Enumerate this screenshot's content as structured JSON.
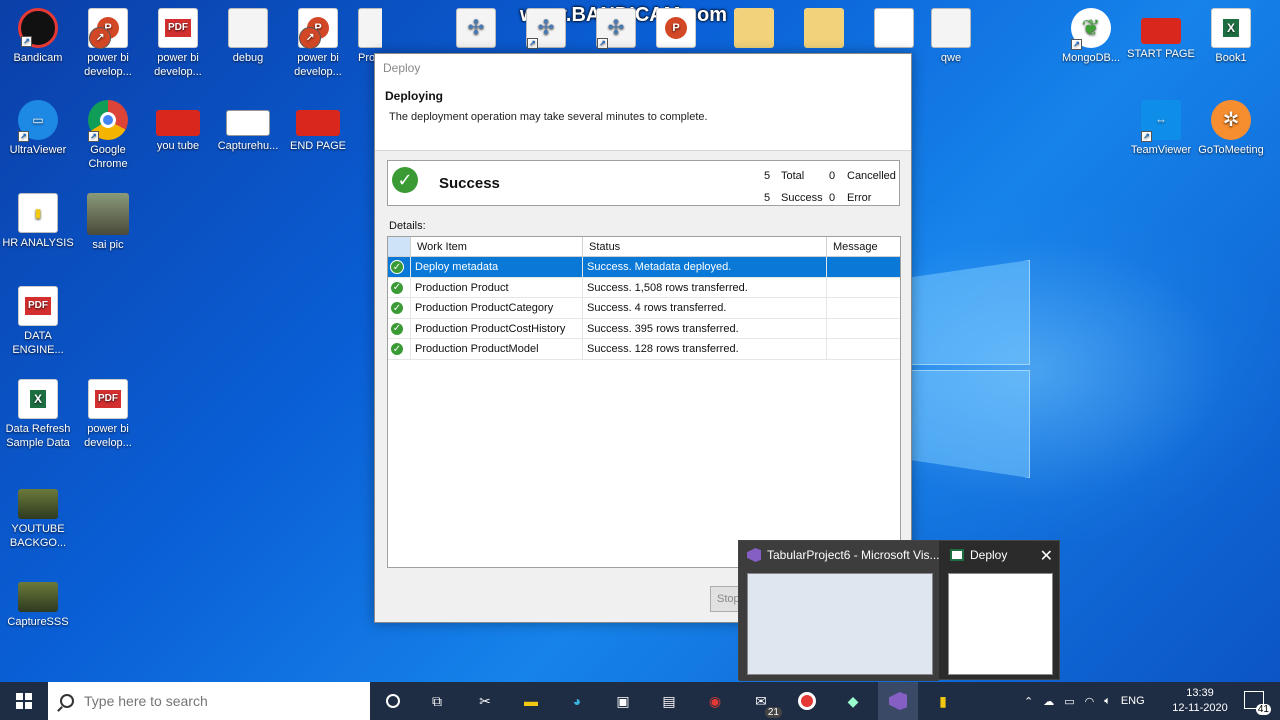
{
  "watermark": "www.BANDICAM.com",
  "desktop": {
    "icons": [
      {
        "label": "Bandicam",
        "icon": "bandicam-icon"
      },
      {
        "label": "power bi develop...",
        "icon": "powerpoint-icon"
      },
      {
        "label": "power bi develop...",
        "icon": "pdf-icon"
      },
      {
        "label": "debug",
        "icon": "document-icon"
      },
      {
        "label": "power bi develop...",
        "icon": "powerpoint-icon"
      },
      {
        "label": "Pro",
        "icon": "document-icon"
      },
      {
        "label": "qwe",
        "icon": "document-icon"
      },
      {
        "label": "MongoDB...",
        "icon": "mongodb-icon"
      },
      {
        "label": "START PAGE",
        "icon": "slide-icon"
      },
      {
        "label": "Book1",
        "icon": "excel-icon"
      },
      {
        "label": "UltraViewer",
        "icon": "ultraviewer-icon"
      },
      {
        "label": "Google Chrome",
        "icon": "chrome-icon"
      },
      {
        "label": "you tube",
        "icon": "slide-icon"
      },
      {
        "label": "Capturehu...",
        "icon": "image-icon"
      },
      {
        "label": "END PAGE",
        "icon": "slide-icon"
      },
      {
        "label": "TeamViewer",
        "icon": "teamviewer-icon"
      },
      {
        "label": "GoToMeeting",
        "icon": "gotomeeting-icon"
      },
      {
        "label": "HR ANALYSIS",
        "icon": "powerbi-file-icon"
      },
      {
        "label": "sai pic",
        "icon": "photo-icon"
      },
      {
        "label": "DATA ENGINE...",
        "icon": "pdf-icon"
      },
      {
        "label": "Data Refresh Sample Data",
        "icon": "excel-icon"
      },
      {
        "label": "power bi develop...",
        "icon": "pdf-icon"
      },
      {
        "label": "YOUTUBE BACKGO...",
        "icon": "image-icon"
      },
      {
        "label": "CaptureSSS",
        "icon": "image-icon"
      }
    ]
  },
  "dialog": {
    "window_title": "Deploy",
    "heading": "Deploying",
    "subtitle": "The deployment operation may take several minutes to complete.",
    "summary": {
      "status": "Success",
      "total_value": "5",
      "total_label": "Total",
      "cancelled_value": "0",
      "cancelled_label": "Cancelled",
      "success_value": "5",
      "success_label": "Success",
      "error_value": "0",
      "error_label": "Error"
    },
    "details_label": "Details:",
    "columns": {
      "work_item": "Work Item",
      "status": "Status",
      "message": "Message"
    },
    "rows": [
      {
        "work_item": "Deploy metadata",
        "status": "Success. Metadata deployed.",
        "message": "",
        "selected": true
      },
      {
        "work_item": "Production Product",
        "status": "Success. 1,508 rows transferred.",
        "message": ""
      },
      {
        "work_item": "Production ProductCategory",
        "status": "Success. 4 rows transferred.",
        "message": ""
      },
      {
        "work_item": "Production ProductCostHistory",
        "status": "Success. 395 rows transferred.",
        "message": ""
      },
      {
        "work_item": "Production ProductModel",
        "status": "Success. 128 rows transferred.",
        "message": ""
      }
    ],
    "stop_button": "Stop"
  },
  "taskbar_preview": {
    "items": [
      {
        "title": "TabularProject6 - Microsoft Vis...",
        "icon": "visual-studio-icon"
      },
      {
        "title": "Deploy",
        "icon": "deploy-window-icon"
      }
    ]
  },
  "taskbar": {
    "search_placeholder": "Type here to search",
    "mail_badge": "21",
    "language": "ENG",
    "time": "13:39",
    "date": "12-11-2020",
    "notification_count": "41"
  }
}
